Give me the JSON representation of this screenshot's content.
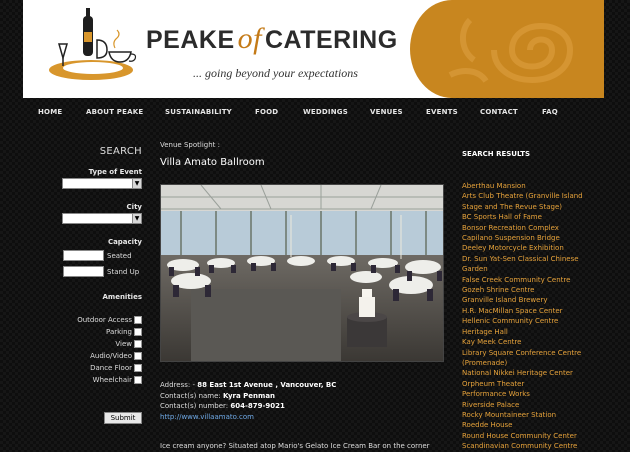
{
  "header": {
    "brand_left": "PEAKE",
    "brand_of": "of",
    "brand_right": "CATERING",
    "tagline": "... going beyond your expectations"
  },
  "nav": [
    "HOME",
    "ABOUT PEAKE",
    "SUSTAINABILITY",
    "FOOD",
    "WEDDINGS",
    "VENUES",
    "EVENTS",
    "CONTACT",
    "FAQ"
  ],
  "search": {
    "title": "SEARCH",
    "type_label": "Type of Event",
    "type_value": "",
    "city_label": "City",
    "city_value": "",
    "capacity_label": "Capacity",
    "seated_label": "Seated",
    "standup_label": "Stand Up",
    "amenities_label": "Amenities",
    "amenities": [
      "Outdoor Access",
      "Parking",
      "View",
      "Audio/Video",
      "Dance Floor",
      "Wheelchair"
    ],
    "submit_label": "Submit"
  },
  "venue": {
    "spotlight_label": "Venue Spotlight :",
    "name": "Villa Amato Ballroom",
    "address_label": "Address: -",
    "address": "88 East 1st Avenue , Vancouver, BC",
    "contact_name_label": "Contact(s) name:",
    "contact_name": "Kyra Penman",
    "contact_number_label": "Contact(s) number:",
    "contact_number": "604-879-9021",
    "url": "http://www.villaamato.com",
    "description": "Ice cream anyone? Situated atop Mario's Gelato Ice Cream Bar on the corner"
  },
  "results": {
    "title": "SEARCH RESULTS",
    "items": [
      "Aberthau Mansion",
      "Arts Club Theatre (Granville Island Stage and The Revue Stage)",
      "BC Sports Hall of Fame",
      "Bonsor Recreation Complex",
      "Capilano Suspension Bridge",
      "Deeley Motorcycle Exhibition",
      "Dr. Sun Yat-Sen Classical Chinese Garden",
      "False Creek Community Centre",
      "Gozeh Shrine Centre",
      "Granville Island Brewery",
      "H.R. MacMillan Space Center",
      "Hellenic Community Centre",
      "Heritage Hall",
      "Kay Meek Centre",
      "Library Square Conference Centre (Promenade)",
      "National Nikkei Heritage Center",
      "Orpheum Theater",
      "Performance Works",
      "Riverside Palace",
      "Rocky Mountaineer Station",
      "Roedde House",
      "Round House Community Center",
      "Scandinavian Community Centre"
    ]
  }
}
